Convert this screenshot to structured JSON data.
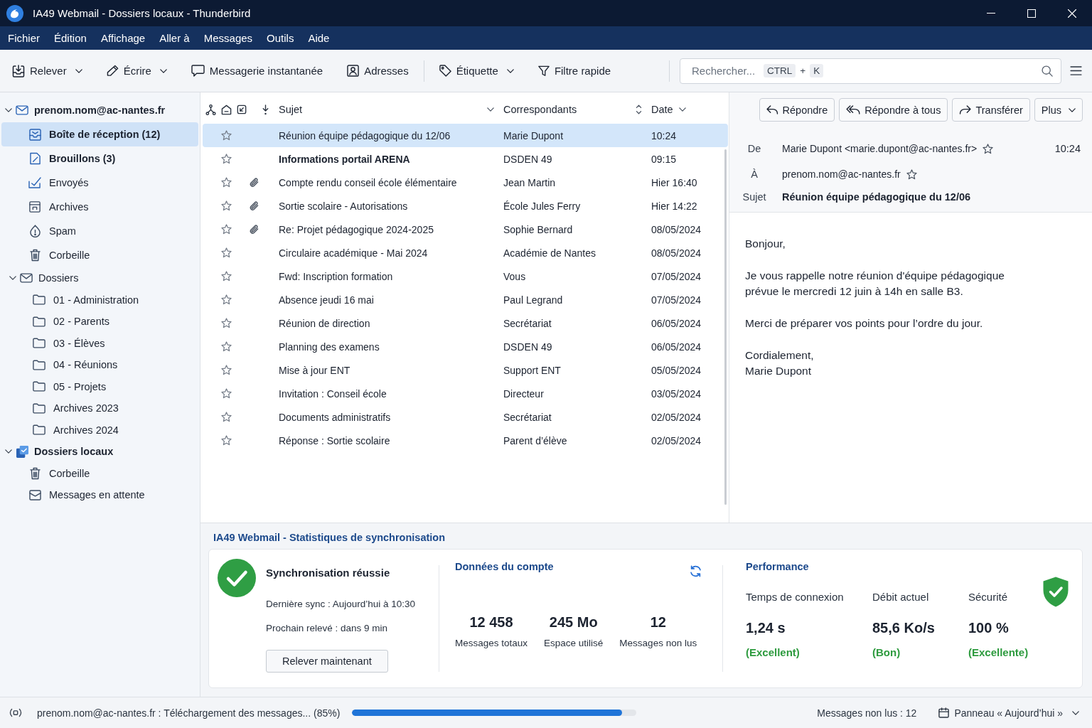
{
  "window": {
    "title": "IA49 Webmail - Dossiers locaux - Thunderbird"
  },
  "menu_bar": {
    "items": [
      "Fichier",
      "Édition",
      "Affichage",
      "Aller à",
      "Messages",
      "Outils",
      "Aide"
    ]
  },
  "toolbar": {
    "groups": [
      [
        {
          "label": "Relever",
          "kind": "get-mail",
          "dropdown": true
        },
        {
          "label": "Écrire",
          "kind": "write",
          "dropdown": true
        },
        {
          "label": "Messagerie instantanée",
          "kind": "chat",
          "dropdown": false
        },
        {
          "label": "Adresses",
          "kind": "contacts",
          "dropdown": false
        }
      ],
      [
        {
          "label": "Étiquette",
          "kind": "tag",
          "dropdown": true
        },
        {
          "label": "Filtre rapide",
          "kind": "filter",
          "dropdown": false
        }
      ]
    ],
    "search": {
      "placeholder": "Rechercher...",
      "shortcut_keys": [
        "CTRL",
        "K"
      ],
      "shortcut_joiner": "+"
    }
  },
  "sidebar": {
    "accounts": [
      {
        "label": "prenom.nom@ac-nantes.fr",
        "kind": "account",
        "selected": false,
        "expanded": true,
        "children": [
          {
            "label": "Boîte de réception (12)",
            "kind": "inbox",
            "selected": true,
            "unread": true
          },
          {
            "label": "Brouillons (3)",
            "kind": "drafts",
            "selected": false,
            "unread": true
          },
          {
            "label": "Envoyés",
            "kind": "sent",
            "selected": false,
            "unread": false
          },
          {
            "label": "Archives",
            "kind": "archive",
            "selected": false,
            "unread": false
          },
          {
            "label": "Spam",
            "kind": "spam",
            "selected": false,
            "unread": false
          },
          {
            "label": "Corbeille",
            "kind": "trash",
            "selected": false,
            "unread": false
          },
          {
            "label": "Dossiers",
            "kind": "group",
            "selected": false,
            "unread": false,
            "expanded": true,
            "children": [
              {
                "label": "01 - Administration",
                "kind": "folder",
                "selected": false,
                "unread": false
              },
              {
                "label": "02 - Parents",
                "kind": "folder",
                "selected": false,
                "unread": false
              },
              {
                "label": "03 - Élèves",
                "kind": "folder",
                "selected": false,
                "unread": false
              },
              {
                "label": "04 - Réunions",
                "kind": "folder",
                "selected": false,
                "unread": false
              },
              {
                "label": "05 - Projets",
                "kind": "folder",
                "selected": false,
                "unread": false
              },
              {
                "label": "Archives 2023",
                "kind": "folder",
                "selected": false,
                "unread": false
              },
              {
                "label": "Archives 2024",
                "kind": "folder",
                "selected": false,
                "unread": false
              }
            ]
          }
        ]
      },
      {
        "label": "Dossiers locaux",
        "kind": "local",
        "selected": false,
        "expanded": true,
        "children": [
          {
            "label": "Corbeille",
            "kind": "trash",
            "selected": false,
            "unread": false
          },
          {
            "label": "Messages en attente",
            "kind": "outbox",
            "selected": false,
            "unread": false
          }
        ]
      }
    ]
  },
  "message_list": {
    "columns": [
      {
        "label": "Sujet",
        "kind": "subject",
        "sorted": false
      },
      {
        "label": "Correspondants",
        "kind": "correspondents",
        "sorted": false
      },
      {
        "label": "Date",
        "kind": "date",
        "sorted": true
      }
    ],
    "rows": [
      {
        "subject": "Réunion équipe pédagogique du 12/06",
        "correspondent": "Marie Dupont",
        "date": "10:24",
        "selected": true,
        "unread": false,
        "starred": false,
        "attachment": false
      },
      {
        "subject": "Informations portail ARENA",
        "correspondent": "DSDEN 49",
        "date": "09:15",
        "selected": false,
        "unread": true,
        "starred": false,
        "attachment": false
      },
      {
        "subject": "Compte rendu conseil école élémentaire",
        "correspondent": "Jean Martin",
        "date": "Hier 16:40",
        "selected": false,
        "unread": false,
        "starred": false,
        "attachment": true
      },
      {
        "subject": "Sortie scolaire - Autorisations",
        "correspondent": "École Jules Ferry",
        "date": "Hier 14:22",
        "selected": false,
        "unread": false,
        "starred": false,
        "attachment": true
      },
      {
        "subject": "Re: Projet pédagogique 2024-2025",
        "correspondent": "Sophie Bernard",
        "date": "08/05/2024",
        "selected": false,
        "unread": false,
        "starred": false,
        "attachment": true
      },
      {
        "subject": "Circulaire académique - Mai 2024",
        "correspondent": "Académie de Nantes",
        "date": "08/05/2024",
        "selected": false,
        "unread": false,
        "starred": false,
        "attachment": false
      },
      {
        "subject": "Fwd: Inscription formation",
        "correspondent": "Vous",
        "date": "07/05/2024",
        "selected": false,
        "unread": false,
        "starred": false,
        "attachment": false
      },
      {
        "subject": "Absence jeudi 16 mai",
        "correspondent": "Paul Legrand",
        "date": "07/05/2024",
        "selected": false,
        "unread": false,
        "starred": false,
        "attachment": false
      },
      {
        "subject": "Réunion de direction",
        "correspondent": "Secrétariat",
        "date": "06/05/2024",
        "selected": false,
        "unread": false,
        "starred": false,
        "attachment": false
      },
      {
        "subject": "Planning des examens",
        "correspondent": "DSDEN 49",
        "date": "06/05/2024",
        "selected": false,
        "unread": false,
        "starred": false,
        "attachment": false
      },
      {
        "subject": "Mise à jour ENT",
        "correspondent": "Support ENT",
        "date": "05/05/2024",
        "selected": false,
        "unread": false,
        "starred": false,
        "attachment": false
      },
      {
        "subject": "Invitation : Conseil école",
        "correspondent": "Directeur",
        "date": "03/05/2024",
        "selected": false,
        "unread": false,
        "starred": false,
        "attachment": false
      },
      {
        "subject": "Documents administratifs",
        "correspondent": "Secrétariat",
        "date": "02/05/2024",
        "selected": false,
        "unread": false,
        "starred": false,
        "attachment": false
      },
      {
        "subject": "Réponse : Sortie scolaire",
        "correspondent": "Parent d’élève",
        "date": "02/05/2024",
        "selected": false,
        "unread": false,
        "starred": false,
        "attachment": false
      }
    ]
  },
  "reading_pane": {
    "actions": [
      {
        "label": "Répondre",
        "kind": "reply"
      },
      {
        "label": "Répondre à tous",
        "kind": "reply-all"
      },
      {
        "label": "Transférer",
        "kind": "forward"
      },
      {
        "label": "Plus",
        "kind": "more"
      }
    ],
    "header_fields": [
      {
        "label": "De",
        "value": "Marie Dupont <marie.dupont@ac-nantes.fr>",
        "kind": "contact",
        "time": "10:24"
      },
      {
        "label": "À",
        "value": "prenom.nom@ac-nantes.fr",
        "kind": "contact"
      },
      {
        "label": "Sujet",
        "value": "Réunion équipe pédagogique du 12/06",
        "kind": "subject"
      }
    ],
    "body": [
      [
        "Bonjour,"
      ],
      [
        "Je vous rappelle notre réunion d'équipe pédagogique",
        "prévue le mercredi 12 juin à 14h en salle B3."
      ],
      [
        "Merci de préparer vos points pour l’ordre du jour."
      ],
      [
        "Cordialement,",
        "Marie Dupont"
      ]
    ]
  },
  "sync_stats": {
    "title": "IA49 Webmail - Statistiques de synchronisation",
    "status": {
      "title": "Synchronisation réussie",
      "details": [
        "Dernière sync : Aujourd’hui à 10:30",
        "Prochain relevé : dans 9 min"
      ],
      "button": "Relever maintenant"
    },
    "account_data": {
      "title": "Données du compte",
      "stats": [
        {
          "value": "12 458",
          "label": "Messages totaux"
        },
        {
          "value": "245 Mo",
          "label": "Espace utilisé"
        },
        {
          "value": "12",
          "label": "Messages non lus"
        }
      ]
    },
    "performance": {
      "title": "Performance",
      "metrics": [
        {
          "label": "Temps de connexion",
          "value": "1,24 s",
          "rating": "(Excellent)"
        },
        {
          "label": "Débit actuel",
          "value": "85,6 Ko/s",
          "rating": "(Bon)"
        },
        {
          "label": "Sécurité",
          "value": "100 %",
          "rating": "(Excellente)"
        }
      ]
    }
  },
  "status_bar": {
    "activity": "prenom.nom@ac-nantes.fr : Téléchargement des messages... (85%)",
    "progress": {
      "level": 0.95
    },
    "unread": "Messages non lus : 12",
    "today_pane": "Panneau « Aujourd’hui »"
  }
}
